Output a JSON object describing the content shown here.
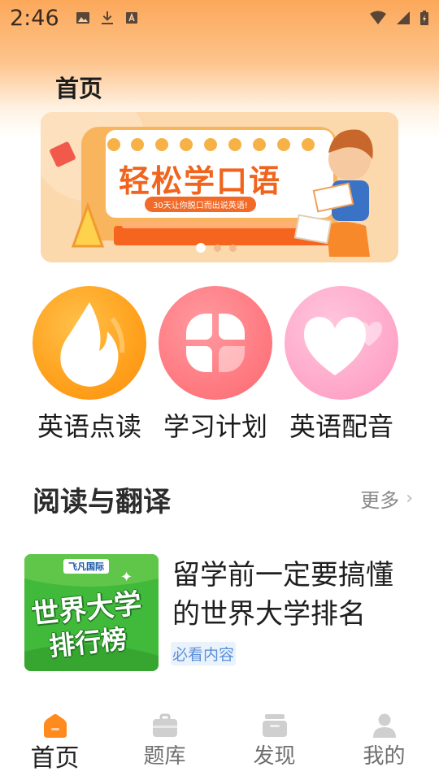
{
  "status_bar": {
    "time": "2:46",
    "left_icons": [
      "image-icon",
      "download-icon",
      "font-a-icon"
    ],
    "right_icons": [
      "wifi-icon",
      "signal-icon",
      "battery-charging-icon"
    ]
  },
  "page_title": "首页",
  "banner": {
    "title": "轻松学口语",
    "subtitle": "30天让你脱口而出说英语!",
    "page_indicator": {
      "count": 3,
      "active_index": 0
    },
    "colors": {
      "accent": "#f0641e",
      "background": "#fcd3a3"
    }
  },
  "features": [
    {
      "label": "英语点读",
      "icon": "flame-icon",
      "color": "#ffa11c"
    },
    {
      "label": "学习计划",
      "icon": "clover-icon",
      "color": "#ff7b82"
    },
    {
      "label": "英语配音",
      "icon": "heart-icon",
      "color": "#ffaacb"
    }
  ],
  "section": {
    "title": "阅读与翻译",
    "more_label": "更多"
  },
  "article": {
    "title": "留学前一定要搞懂的世界大学排名",
    "tag": "必看内容",
    "thumbnail": {
      "brand": "飞凡国际",
      "line1": "世界大学",
      "line2": "排行榜"
    }
  },
  "bottom_nav": {
    "active_index": 0,
    "active_color": "#ff8a1e",
    "items": [
      {
        "label": "首页",
        "icon": "home-icon"
      },
      {
        "label": "题库",
        "icon": "briefcase-icon"
      },
      {
        "label": "发现",
        "icon": "inbox-icon"
      },
      {
        "label": "我的",
        "icon": "user-icon"
      }
    ]
  }
}
